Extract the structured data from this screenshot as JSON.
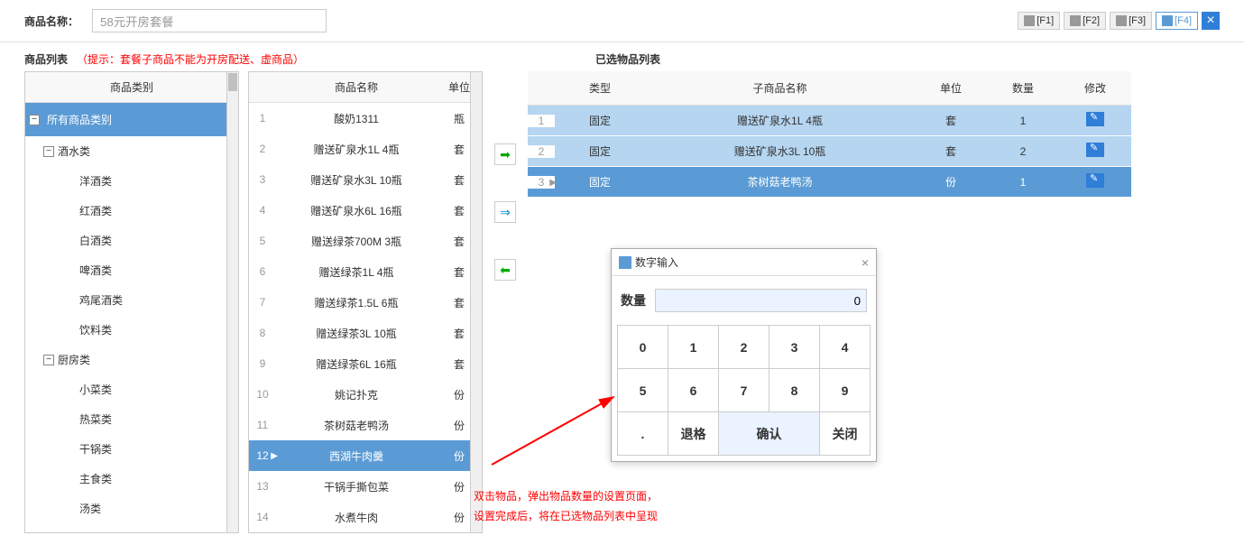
{
  "topBar": {
    "label": "商品名称：",
    "productName": "58元开房套餐",
    "buttons": {
      "f1": "[F1]",
      "f2": "[F2]",
      "f3": "[F3]",
      "f4": "[F4]"
    }
  },
  "listSection": {
    "title": "商品列表",
    "hint": "（提示：套餐子商品不能为开房配送、虚商品）",
    "selectedTitle": "已选物品列表"
  },
  "categoryPanel": {
    "header": "商品类别",
    "items": [
      {
        "label": "所有商品类别",
        "depth": 0,
        "toggle": "−",
        "selected": true
      },
      {
        "label": "酒水类",
        "depth": 1,
        "toggle": "−"
      },
      {
        "label": "洋酒类",
        "depth": 2
      },
      {
        "label": "红酒类",
        "depth": 2
      },
      {
        "label": "白酒类",
        "depth": 2
      },
      {
        "label": "啤酒类",
        "depth": 2
      },
      {
        "label": "鸡尾酒类",
        "depth": 2
      },
      {
        "label": "饮料类",
        "depth": 2
      },
      {
        "label": "厨房类",
        "depth": 1,
        "toggle": "−"
      },
      {
        "label": "小菜类",
        "depth": 2
      },
      {
        "label": "热菜类",
        "depth": 2
      },
      {
        "label": "干锅类",
        "depth": 2
      },
      {
        "label": "主食类",
        "depth": 2
      },
      {
        "label": "汤类",
        "depth": 2
      }
    ]
  },
  "productsPanel": {
    "headers": {
      "name": "商品名称",
      "unit": "单位"
    },
    "rows": [
      {
        "num": "1",
        "name": "酸奶1311",
        "unit": "瓶"
      },
      {
        "num": "2",
        "name": "赠送矿泉水1L 4瓶",
        "unit": "套"
      },
      {
        "num": "3",
        "name": "赠送矿泉水3L 10瓶",
        "unit": "套"
      },
      {
        "num": "4",
        "name": "赠送矿泉水6L 16瓶",
        "unit": "套"
      },
      {
        "num": "5",
        "name": "赠送绿茶700M  3瓶",
        "unit": "套"
      },
      {
        "num": "6",
        "name": "赠送绿茶1L 4瓶",
        "unit": "套"
      },
      {
        "num": "7",
        "name": "赠送绿茶1.5L 6瓶",
        "unit": "套"
      },
      {
        "num": "8",
        "name": "赠送绿茶3L  10瓶",
        "unit": "套"
      },
      {
        "num": "9",
        "name": "赠送绿茶6L  16瓶",
        "unit": "套"
      },
      {
        "num": "10",
        "name": "姚记扑克",
        "unit": "份"
      },
      {
        "num": "11",
        "name": "茶树菇老鸭汤",
        "unit": "份"
      },
      {
        "num": "12",
        "name": "西湖牛肉羹",
        "unit": "份",
        "selected": true
      },
      {
        "num": "13",
        "name": "干锅手撕包菜",
        "unit": "份"
      },
      {
        "num": "14",
        "name": "水煮牛肉",
        "unit": "份"
      }
    ]
  },
  "selectedPanel": {
    "headers": {
      "type": "类型",
      "name": "子商品名称",
      "unit": "单位",
      "qty": "数量",
      "edit": "修改"
    },
    "rows": [
      {
        "num": "1",
        "type": "固定",
        "name": "赠送矿泉水1L 4瓶",
        "unit": "套",
        "qty": "1"
      },
      {
        "num": "2",
        "type": "固定",
        "name": "赠送矿泉水3L 10瓶",
        "unit": "套",
        "qty": "2"
      },
      {
        "num": "3",
        "type": "固定",
        "name": "茶树菇老鸭汤",
        "unit": "份",
        "qty": "1",
        "selected": true
      }
    ]
  },
  "numpad": {
    "title": "数字输入",
    "qtyLabel": "数量",
    "qtyValue": "0",
    "keys": [
      "0",
      "1",
      "2",
      "3",
      "4",
      "5",
      "6",
      "7",
      "8",
      "9"
    ],
    "dot": ".",
    "backspace": "退格",
    "confirm": "确认",
    "close": "关闭"
  },
  "annotation": {
    "line1": "双击物品，弹出物品数量的设置页面，",
    "line2": "设置完成后，将在已选物品列表中呈现"
  }
}
